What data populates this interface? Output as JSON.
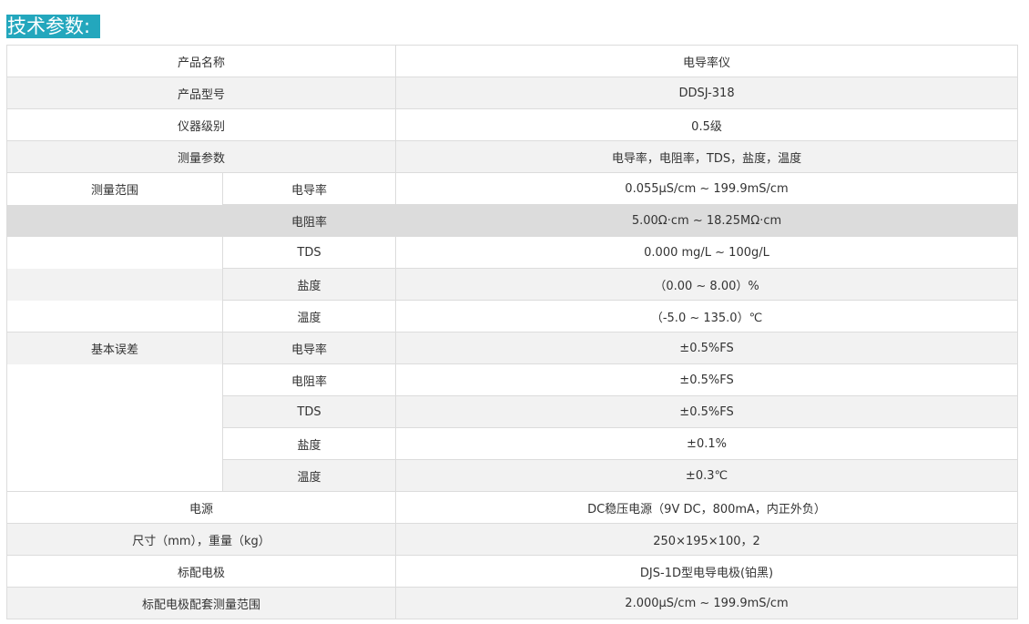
{
  "heading": "技术参数:",
  "rows": [
    {
      "label": "产品名称",
      "value": "电导率仪"
    },
    {
      "label": "产品型号",
      "value": "DDSJ-318"
    },
    {
      "label": "仪器级别",
      "value": "0.5级"
    },
    {
      "label": "测量参数",
      "value": "电导率，电阻率，TDS，盐度，温度"
    }
  ],
  "measure_range": {
    "label": "测量范围",
    "items": [
      {
        "sub": "电导率",
        "value": "0.055μS/cm ~ 199.9mS/cm"
      },
      {
        "sub": "电阻率",
        "value": "5.00Ω·cm ~ 18.25MΩ·cm"
      },
      {
        "sub": "TDS",
        "value": "0.000 mg/L ~ 100g/L"
      },
      {
        "sub": "盐度",
        "value": "（0.00 ~ 8.00）%"
      },
      {
        "sub": "温度",
        "value": "（-5.0 ~ 135.0）℃"
      }
    ]
  },
  "basic_error": {
    "label": "基本误差",
    "items": [
      {
        "sub": "电导率",
        "value": "±0.5%FS"
      },
      {
        "sub": "电阻率",
        "value": "±0.5%FS"
      },
      {
        "sub": "TDS",
        "value": "±0.5%FS"
      },
      {
        "sub": "盐度",
        "value": "±0.1%"
      },
      {
        "sub": "温度",
        "value": "±0.3℃"
      }
    ]
  },
  "rows_after": [
    {
      "label": "电源",
      "value": "DC稳压电源（9V DC，800mA，内正外负）"
    },
    {
      "label": "尺寸（mm），重量（kg）",
      "value": "250×195×100，2"
    },
    {
      "label": "标配电极",
      "value": "DJS-1D型电导电极(铂黑)"
    },
    {
      "label": "标配电极配套测量范围",
      "value": "2.000μS/cm ~ 199.9mS/cm"
    }
  ]
}
